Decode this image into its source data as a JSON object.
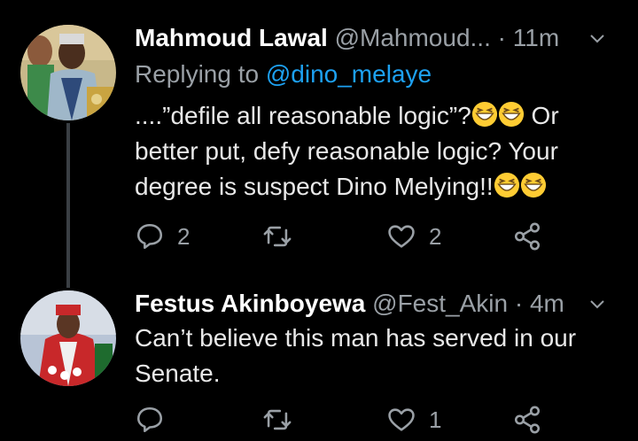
{
  "tweets": [
    {
      "name": "Mahmoud Lawal",
      "handle": "@Mahmoud...",
      "separator": "·",
      "time": "11m",
      "replying_prefix": "Replying to",
      "replying_to": "@dino_melaye",
      "text_lines": [
        "....”defile all reasonable logic”?",
        "Or",
        "better put, defy reasonable logic? Your",
        "degree is suspect Dino Melying!!"
      ],
      "emoji": "grinning-squinting-face",
      "actions": {
        "replies": "2",
        "retweets": "",
        "likes": "2"
      }
    },
    {
      "name": "Festus Akinboyewa",
      "handle": "@Fest_Akin",
      "separator": "·",
      "time": "4m",
      "text_lines": [
        "Can’t believe this man has served in our",
        "Senate."
      ],
      "actions": {
        "replies": "",
        "retweets": "",
        "likes": "1"
      }
    }
  ],
  "icons": {
    "reply": "reply-icon",
    "retweet": "retweet-icon",
    "like": "heart-icon",
    "share": "share-icon",
    "menu": "chevron-down-icon"
  },
  "colors": {
    "background": "#000000",
    "text": "#e8e8e8",
    "secondary": "#9aa0a6",
    "link": "#1da1f2"
  }
}
